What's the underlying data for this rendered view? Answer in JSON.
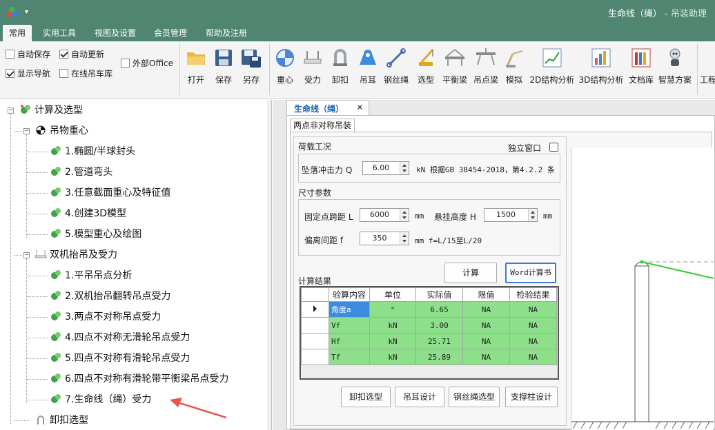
{
  "window": {
    "title": "生命线（绳）",
    "subtitle": "- 吊装助理",
    "menu_arrow": "▾"
  },
  "menu_tabs": [
    "常用",
    "实用工具",
    "视图及设置",
    "会员管理",
    "帮助及注册"
  ],
  "ribbon": {
    "checkboxes": [
      {
        "label": "自动保存",
        "checked": false
      },
      {
        "label": "自动更新",
        "checked": true
      },
      {
        "label": "显示导航",
        "checked": true
      },
      {
        "label": "在线吊车库",
        "checked": false
      },
      {
        "label": "外部Office",
        "checked": false
      }
    ],
    "buttons": [
      {
        "label": "打开",
        "icon": "folder-open-icon"
      },
      {
        "label": "保存",
        "icon": "save-icon"
      },
      {
        "label": "另存",
        "icon": "save-as-icon"
      },
      {
        "label": "重心",
        "icon": "center-of-gravity-icon"
      },
      {
        "label": "受力",
        "icon": "force-icon"
      },
      {
        "label": "卸扣",
        "icon": "shackle-icon"
      },
      {
        "label": "吊耳",
        "icon": "lifting-lug-icon"
      },
      {
        "label": "钢丝绳",
        "icon": "wire-rope-icon"
      },
      {
        "label": "选型",
        "icon": "crane-select-icon"
      },
      {
        "label": "平衡梁",
        "icon": "spreader-beam-icon"
      },
      {
        "label": "吊点梁",
        "icon": "lifting-beam-icon"
      },
      {
        "label": "模拟",
        "icon": "simulation-icon"
      },
      {
        "label": "2D结构分析",
        "icon": "chart-2d-icon"
      },
      {
        "label": "3D结构分析",
        "icon": "chart-3d-icon"
      },
      {
        "label": "文档库",
        "icon": "document-library-icon"
      },
      {
        "label": "智慧方案",
        "icon": "robot-icon"
      },
      {
        "label": "工程",
        "icon": "project-icon"
      }
    ]
  },
  "tree": {
    "root": "计算及选型",
    "groups": [
      {
        "label": "吊物重心",
        "items": [
          "1.椭圆/半球封头",
          "2.管道弯头",
          "3.任意截面重心及特征值",
          "4.创建3D模型",
          "5.模型重心及绘图"
        ]
      },
      {
        "label": "双机抬吊及受力",
        "items": [
          "1.平吊吊点分析",
          "2.双机抬吊翻转吊点受力",
          "3.两点不对称吊点受力",
          "4.四点不对称无滑轮吊点受力",
          "5.四点不对称有滑轮吊点受力",
          "6.四点不对称有滑轮带平衡梁吊点受力",
          "7.生命线（绳）受力"
        ]
      },
      {
        "label": "卸扣选型",
        "items": []
      }
    ]
  },
  "document": {
    "tab_title": "生命线（绳）",
    "tab_close": "×",
    "sub_tab": "两点非对称吊装",
    "load_section": {
      "title": "荷载工况",
      "standalone_label": "独立窗口",
      "standalone_checked": false,
      "impact_label": "坠落冲击力 Q",
      "impact_value": "6.00",
      "impact_note": "kN 根据GB 38454-2018，第4.2.2 条"
    },
    "size_section": {
      "title": "尺寸参数",
      "span_label": "固定点跨距 L",
      "span_value": "6000",
      "span_unit": "mm",
      "height_label": "悬挂高度 H",
      "height_value": "1500",
      "height_unit": "mm",
      "offset_label": "偏离间距 f",
      "offset_value": "350",
      "offset_note": "mm f=L/15至L/20"
    },
    "buttons": {
      "calc": "计算",
      "word": "Word计算书",
      "shackle": "卸扣选型",
      "lug": "吊耳设计",
      "rope": "钢丝绳选型",
      "column": "支撑柱设计"
    },
    "results": {
      "title": "计算结果",
      "columns": [
        "验算内容",
        "单位",
        "实际值",
        "限值",
        "检验结果"
      ],
      "rows": [
        [
          "角度a",
          "°",
          "6.65",
          "NA",
          "NA"
        ],
        [
          "Vf",
          "kN",
          "3.00",
          "NA",
          "NA"
        ],
        [
          "Hf",
          "kN",
          "25.71",
          "NA",
          "NA"
        ],
        [
          "Tf",
          "kN",
          "25.89",
          "NA",
          "NA"
        ]
      ]
    }
  },
  "colors": {
    "title_bar": "#4f8571",
    "grid_cell": "#8ddf8a",
    "selected_cell": "#3c8ce0",
    "arrow": "#e8534f",
    "rope_line": "#33cc33"
  }
}
